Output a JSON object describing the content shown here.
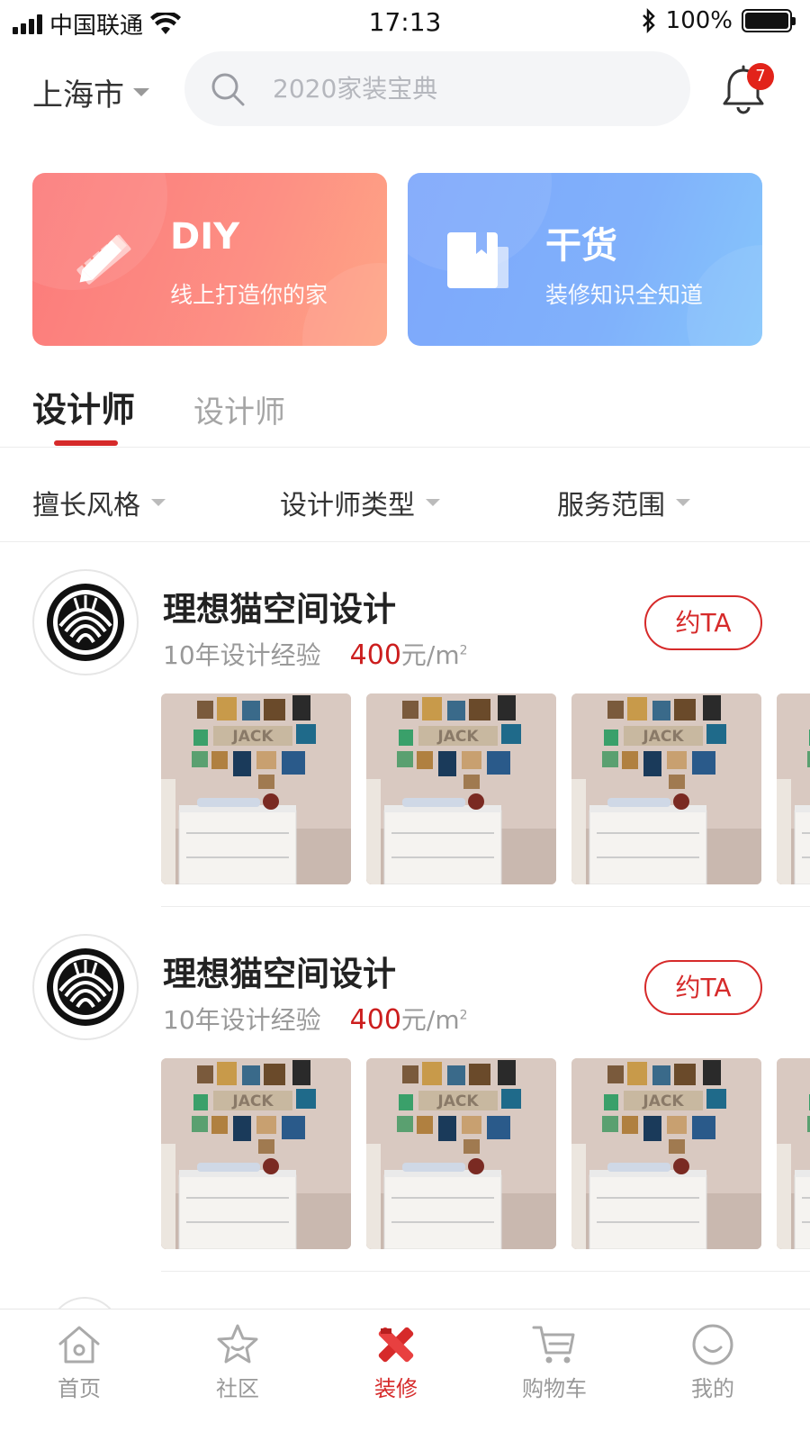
{
  "status_bar": {
    "carrier": "中国联通",
    "time": "17:13",
    "battery": "100%"
  },
  "header": {
    "city": "上海市",
    "search_placeholder": "2020家装宝典",
    "notification_count": "7"
  },
  "banners": [
    {
      "title": "DIY",
      "subtitle": "线上打造你的家",
      "icon": "pencil-ruler-icon",
      "color": "#fb7a7a"
    },
    {
      "title": "干货",
      "subtitle": "装修知识全知道",
      "icon": "book-icon",
      "color": "#7da7fb"
    }
  ],
  "tabs": [
    {
      "label": "设计师",
      "active": true
    },
    {
      "label": "设计师",
      "active": false
    }
  ],
  "filters": [
    {
      "label": "擅长风格"
    },
    {
      "label": "设计师类型"
    },
    {
      "label": "服务范围"
    }
  ],
  "designers": [
    {
      "name": "理想猫空间设计",
      "experience": "10年设计经验",
      "price": "400",
      "price_unit": "元/m",
      "price_sup": "2",
      "button": "约TA"
    },
    {
      "name": "理想猫空间设计",
      "experience": "10年设计经验",
      "price": "400",
      "price_unit": "元/m",
      "price_sup": "2",
      "button": "约TA"
    }
  ],
  "bottom_nav": [
    {
      "label": "首页",
      "icon": "home-icon",
      "active": false
    },
    {
      "label": "社区",
      "icon": "star-icon",
      "active": false
    },
    {
      "label": "装修",
      "icon": "renovation-icon",
      "active": true
    },
    {
      "label": "购物车",
      "icon": "cart-icon",
      "active": false
    },
    {
      "label": "我的",
      "icon": "smile-icon",
      "active": false
    }
  ],
  "colors": {
    "accent": "#d62a2a",
    "badge": "#e2231a",
    "diy_banner": "#fb7a7a",
    "tips_banner": "#7da7fb"
  }
}
